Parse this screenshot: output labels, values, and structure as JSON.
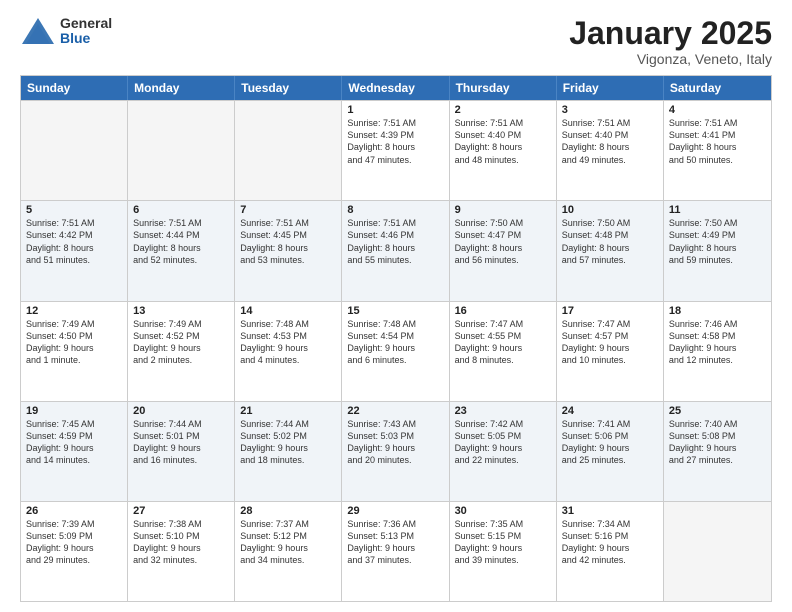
{
  "logo": {
    "general": "General",
    "blue": "Blue"
  },
  "header": {
    "title": "January 2025",
    "subtitle": "Vigonza, Veneto, Italy"
  },
  "weekdays": [
    "Sunday",
    "Monday",
    "Tuesday",
    "Wednesday",
    "Thursday",
    "Friday",
    "Saturday"
  ],
  "rows": [
    [
      {
        "day": "",
        "info": ""
      },
      {
        "day": "",
        "info": ""
      },
      {
        "day": "",
        "info": ""
      },
      {
        "day": "1",
        "info": "Sunrise: 7:51 AM\nSunset: 4:39 PM\nDaylight: 8 hours\nand 47 minutes."
      },
      {
        "day": "2",
        "info": "Sunrise: 7:51 AM\nSunset: 4:40 PM\nDaylight: 8 hours\nand 48 minutes."
      },
      {
        "day": "3",
        "info": "Sunrise: 7:51 AM\nSunset: 4:40 PM\nDaylight: 8 hours\nand 49 minutes."
      },
      {
        "day": "4",
        "info": "Sunrise: 7:51 AM\nSunset: 4:41 PM\nDaylight: 8 hours\nand 50 minutes."
      }
    ],
    [
      {
        "day": "5",
        "info": "Sunrise: 7:51 AM\nSunset: 4:42 PM\nDaylight: 8 hours\nand 51 minutes."
      },
      {
        "day": "6",
        "info": "Sunrise: 7:51 AM\nSunset: 4:44 PM\nDaylight: 8 hours\nand 52 minutes."
      },
      {
        "day": "7",
        "info": "Sunrise: 7:51 AM\nSunset: 4:45 PM\nDaylight: 8 hours\nand 53 minutes."
      },
      {
        "day": "8",
        "info": "Sunrise: 7:51 AM\nSunset: 4:46 PM\nDaylight: 8 hours\nand 55 minutes."
      },
      {
        "day": "9",
        "info": "Sunrise: 7:50 AM\nSunset: 4:47 PM\nDaylight: 8 hours\nand 56 minutes."
      },
      {
        "day": "10",
        "info": "Sunrise: 7:50 AM\nSunset: 4:48 PM\nDaylight: 8 hours\nand 57 minutes."
      },
      {
        "day": "11",
        "info": "Sunrise: 7:50 AM\nSunset: 4:49 PM\nDaylight: 8 hours\nand 59 minutes."
      }
    ],
    [
      {
        "day": "12",
        "info": "Sunrise: 7:49 AM\nSunset: 4:50 PM\nDaylight: 9 hours\nand 1 minute."
      },
      {
        "day": "13",
        "info": "Sunrise: 7:49 AM\nSunset: 4:52 PM\nDaylight: 9 hours\nand 2 minutes."
      },
      {
        "day": "14",
        "info": "Sunrise: 7:48 AM\nSunset: 4:53 PM\nDaylight: 9 hours\nand 4 minutes."
      },
      {
        "day": "15",
        "info": "Sunrise: 7:48 AM\nSunset: 4:54 PM\nDaylight: 9 hours\nand 6 minutes."
      },
      {
        "day": "16",
        "info": "Sunrise: 7:47 AM\nSunset: 4:55 PM\nDaylight: 9 hours\nand 8 minutes."
      },
      {
        "day": "17",
        "info": "Sunrise: 7:47 AM\nSunset: 4:57 PM\nDaylight: 9 hours\nand 10 minutes."
      },
      {
        "day": "18",
        "info": "Sunrise: 7:46 AM\nSunset: 4:58 PM\nDaylight: 9 hours\nand 12 minutes."
      }
    ],
    [
      {
        "day": "19",
        "info": "Sunrise: 7:45 AM\nSunset: 4:59 PM\nDaylight: 9 hours\nand 14 minutes."
      },
      {
        "day": "20",
        "info": "Sunrise: 7:44 AM\nSunset: 5:01 PM\nDaylight: 9 hours\nand 16 minutes."
      },
      {
        "day": "21",
        "info": "Sunrise: 7:44 AM\nSunset: 5:02 PM\nDaylight: 9 hours\nand 18 minutes."
      },
      {
        "day": "22",
        "info": "Sunrise: 7:43 AM\nSunset: 5:03 PM\nDaylight: 9 hours\nand 20 minutes."
      },
      {
        "day": "23",
        "info": "Sunrise: 7:42 AM\nSunset: 5:05 PM\nDaylight: 9 hours\nand 22 minutes."
      },
      {
        "day": "24",
        "info": "Sunrise: 7:41 AM\nSunset: 5:06 PM\nDaylight: 9 hours\nand 25 minutes."
      },
      {
        "day": "25",
        "info": "Sunrise: 7:40 AM\nSunset: 5:08 PM\nDaylight: 9 hours\nand 27 minutes."
      }
    ],
    [
      {
        "day": "26",
        "info": "Sunrise: 7:39 AM\nSunset: 5:09 PM\nDaylight: 9 hours\nand 29 minutes."
      },
      {
        "day": "27",
        "info": "Sunrise: 7:38 AM\nSunset: 5:10 PM\nDaylight: 9 hours\nand 32 minutes."
      },
      {
        "day": "28",
        "info": "Sunrise: 7:37 AM\nSunset: 5:12 PM\nDaylight: 9 hours\nand 34 minutes."
      },
      {
        "day": "29",
        "info": "Sunrise: 7:36 AM\nSunset: 5:13 PM\nDaylight: 9 hours\nand 37 minutes."
      },
      {
        "day": "30",
        "info": "Sunrise: 7:35 AM\nSunset: 5:15 PM\nDaylight: 9 hours\nand 39 minutes."
      },
      {
        "day": "31",
        "info": "Sunrise: 7:34 AM\nSunset: 5:16 PM\nDaylight: 9 hours\nand 42 minutes."
      },
      {
        "day": "",
        "info": ""
      }
    ]
  ]
}
